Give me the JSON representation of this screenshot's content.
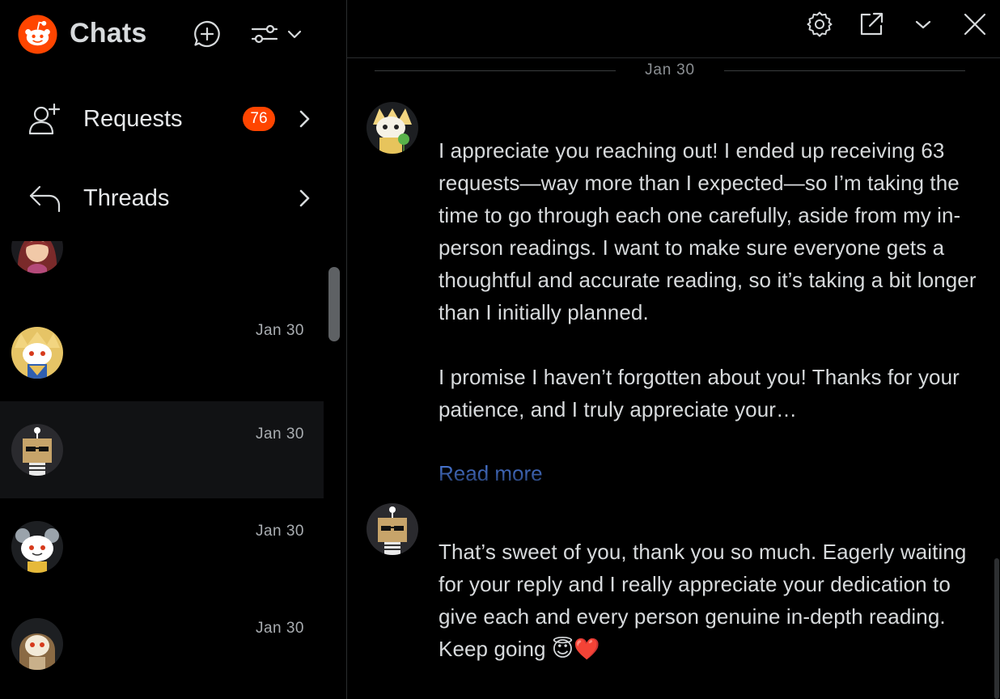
{
  "sidebar": {
    "title": "Chats",
    "new_chat_icon": "new-chat-icon",
    "filter_icon": "filter-icon",
    "nav": [
      {
        "label": "Requests",
        "icon": "add-user-icon",
        "badge": "76"
      },
      {
        "label": "Threads",
        "icon": "reply-icon"
      }
    ],
    "chats": [
      {
        "name": "",
        "preview": "",
        "date": ""
      },
      {
        "name": "",
        "preview": "",
        "date": "Jan 30"
      },
      {
        "name": "",
        "preview": "",
        "date": "Jan 30",
        "selected": true
      },
      {
        "name": "",
        "preview": "",
        "date": "Jan 30"
      },
      {
        "name": "",
        "preview": "",
        "date": "Jan 30"
      }
    ]
  },
  "main": {
    "title": "",
    "toolbar_icons": [
      "gear-icon",
      "popout-icon",
      "chevron-down-icon",
      "close-icon"
    ],
    "date_separator": "Jan 30",
    "messages": [
      {
        "author": "",
        "time": "",
        "paragraphs": [
          "I appreciate you reaching out! I ended up receiving 63 requests—way more than I expected—so I’m taking the time to go through each one carefully, aside from my in-person readings. I want to make sure everyone gets a thoughtful and accurate reading, so it’s taking a bit longer than I initially planned.",
          "I promise I haven’t forgotten about you! Thanks for your patience, and I truly appreciate your…"
        ],
        "read_more": "Read more"
      },
      {
        "author": "",
        "time": "",
        "paragraphs": [
          "That’s sweet of you, thank you so much. Eagerly waiting for your reply and I really appreciate your dedication to give each and every person genuine in-depth reading.",
          "Keep going 😇❤️"
        ]
      }
    ]
  },
  "colors": {
    "brand": "#ff4500",
    "background": "#000000",
    "text": "#d7dadc",
    "link": "#4a78d6",
    "selected_row": "#111214"
  }
}
